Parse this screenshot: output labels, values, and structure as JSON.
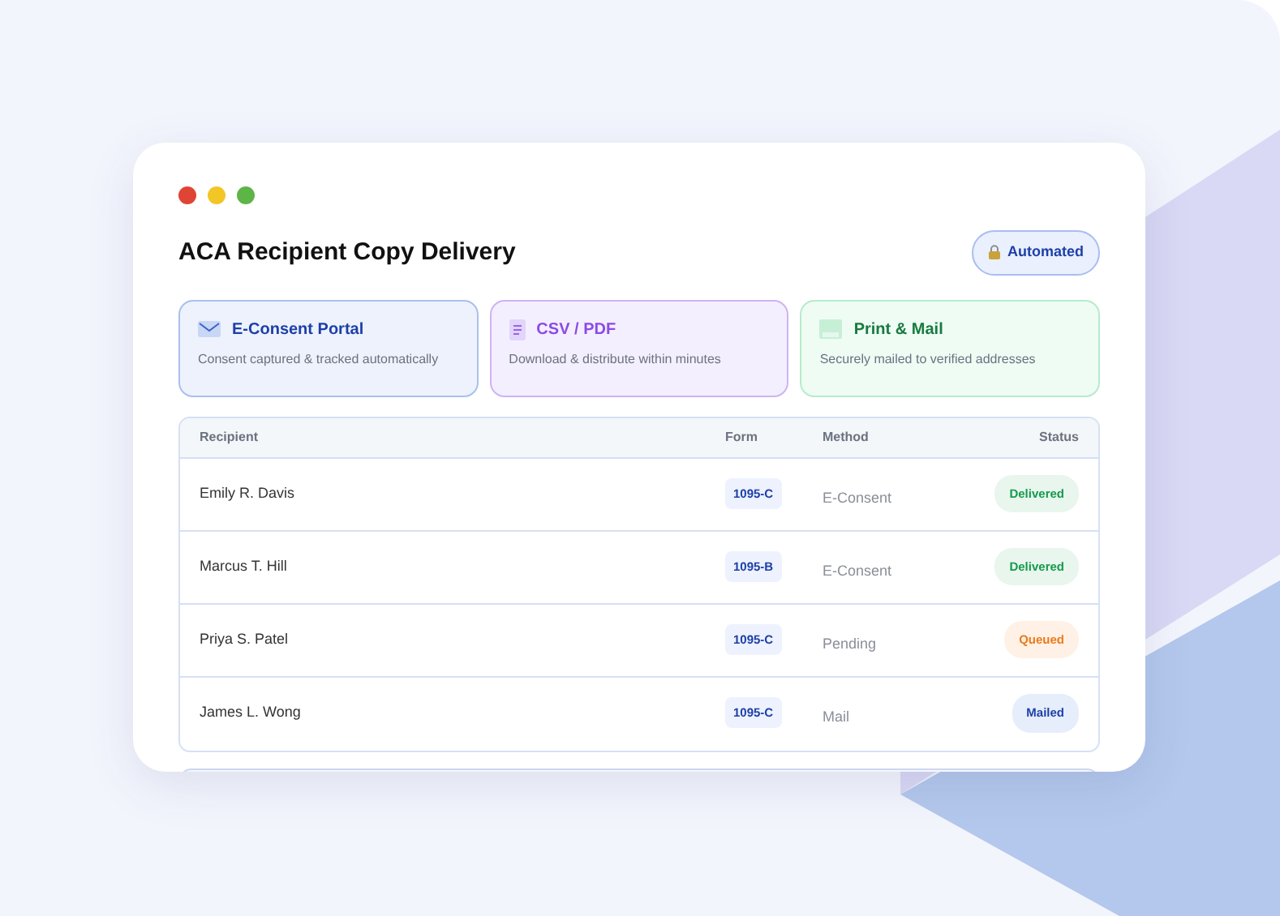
{
  "window": {
    "title": "ACA Recipient Copy Delivery",
    "badge": "Automated"
  },
  "channels": [
    {
      "kind": "econsent",
      "title": "E-Consent Portal",
      "description": "Consent captured & tracked automatically"
    },
    {
      "kind": "file",
      "title": "CSV / PDF",
      "description": "Download & distribute within minutes"
    },
    {
      "kind": "mail",
      "title": "Print & Mail",
      "description": "Securely mailed to verified addresses"
    }
  ],
  "table": {
    "columns": [
      "Recipient",
      "Form",
      "Method",
      "Status"
    ],
    "rows": [
      {
        "recipient": "Emily R. Davis",
        "form": "1095-C",
        "method": "E-Consent",
        "status": {
          "label": "Delivered",
          "kind": "delivered"
        }
      },
      {
        "recipient": "Marcus T. Hill",
        "form": "1095-B",
        "method": "E-Consent",
        "status": {
          "label": "Delivered",
          "kind": "delivered"
        }
      },
      {
        "recipient": "Priya S. Patel",
        "form": "1095-C",
        "method": "Pending",
        "status": {
          "label": "Queued",
          "kind": "queued"
        }
      },
      {
        "recipient": "James L. Wong",
        "form": "1095-C",
        "method": "Mail",
        "status": {
          "label": "Mailed",
          "kind": "mailed"
        }
      }
    ]
  }
}
